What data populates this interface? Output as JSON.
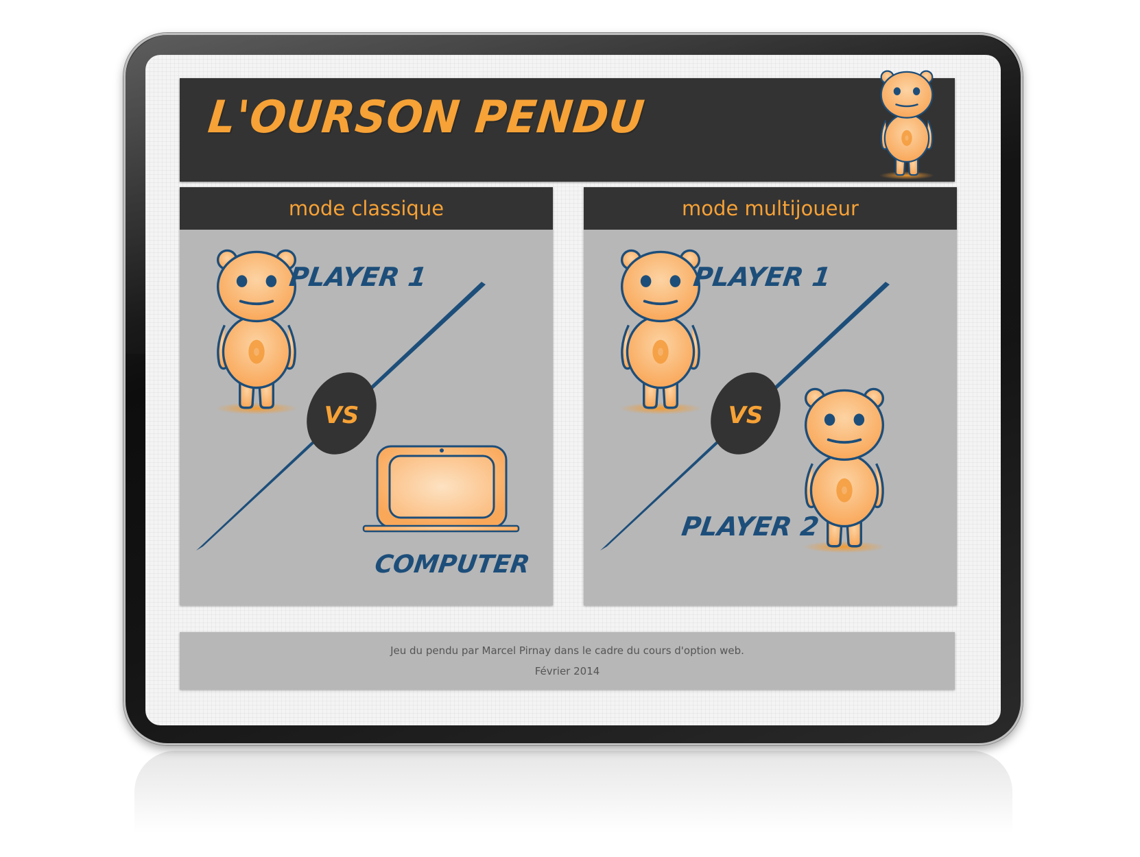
{
  "header": {
    "title": "L'OURSON PENDU",
    "mascot_icon": "bear-mascot-icon"
  },
  "modes": [
    {
      "label": "mode classique",
      "player1": "PLAYER 1",
      "versus": "VS",
      "opponent": "COMPUTER"
    },
    {
      "label": "mode multijoueur",
      "player1": "PLAYER 1",
      "versus": "VS",
      "opponent": "PLAYER 2"
    }
  ],
  "footer": {
    "line1": "Jeu du pendu par Marcel Pirnay dans le cadre du cours d'option web.",
    "line2": "Février 2014"
  },
  "colors": {
    "accent": "#f7a236",
    "dark": "#333333",
    "panel": "#b7b7b7",
    "bear_fill": "#fbb36a",
    "bear_outline": "#1d4e7a"
  }
}
